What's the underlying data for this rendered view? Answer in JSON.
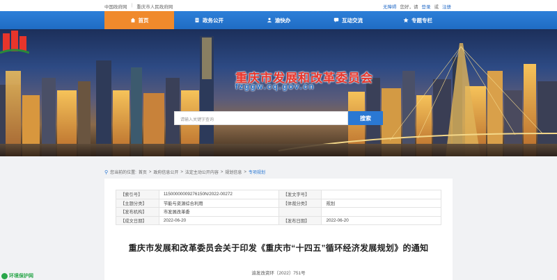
{
  "topbar": {
    "gov_link": "中国政府网",
    "city_link": "重庆市人民政府网",
    "accessibility": "无障碍",
    "greeting": "您好，请",
    "login": "登录",
    "or": "或",
    "register": "注册"
  },
  "nav": {
    "items": [
      {
        "label": "首页",
        "icon": "home-icon"
      },
      {
        "label": "政务公开",
        "icon": "document-icon"
      },
      {
        "label": "渝快办",
        "icon": "person-icon"
      },
      {
        "label": "互动交流",
        "icon": "chat-icon"
      },
      {
        "label": "专题专栏",
        "icon": "star-icon"
      }
    ]
  },
  "banner": {
    "site_name": "重庆市发展和改革委员会",
    "domain": "fzggw.cq.gov.cn",
    "search_placeholder": "请输入关键字查询",
    "search_button": "搜索"
  },
  "breadcrumb": {
    "prefix": "您当前的位置:",
    "items": [
      "首页",
      "政府信息公开",
      "法定主动公开内容",
      "规划信息"
    ],
    "current": "专项规划"
  },
  "meta": {
    "rows": [
      {
        "k1": "【索引号】",
        "v1": "11500000009276150N/2022-00272",
        "k2": "【发文字号】",
        "v2": ""
      },
      {
        "k1": "【主题分类】",
        "v1": "节能与资源综合利用",
        "k2": "【体裁分类】",
        "v2": "规划"
      },
      {
        "k1": "【发布机构】",
        "v1": "市发展改革委",
        "k2": "",
        "v2": ""
      },
      {
        "k1": "【成文日期】",
        "v1": "2022-06-20",
        "k2": "【发布日期】",
        "v2": "2022-06-20"
      }
    ]
  },
  "document": {
    "title": "重庆市发展和改革委员会关于印发《重庆市“十四五”循环经济发展规划》的通知",
    "number": "渝发改资环〔2022〕751号"
  },
  "badge": {
    "label": "环境保护网"
  },
  "colors": {
    "nav_blue": "#1f6cc4",
    "active_orange": "#f08a2c",
    "title_red": "#e8352b"
  }
}
